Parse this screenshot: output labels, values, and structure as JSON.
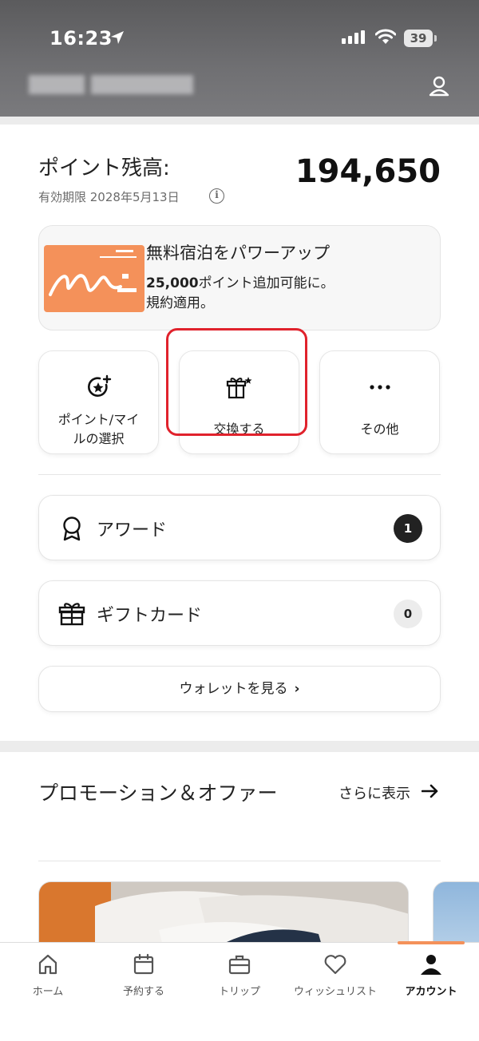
{
  "status_bar": {
    "time": "16:23",
    "battery": "39"
  },
  "points": {
    "label": "ポイント残高:",
    "value": "194,650",
    "expiry": "有効期限 2028年5月13日"
  },
  "promo_card": {
    "title": "無料宿泊をパワーアップ",
    "desc_bold": "25,000",
    "desc_rest": "ポイント追加可能に。",
    "desc_line2": "規約適用。"
  },
  "actions": [
    {
      "label_line1": "ポイント/マイ",
      "label_line2": "ルの選択",
      "icon": "star-plus-icon"
    },
    {
      "label_line1": "交換する",
      "icon": "gift-sparkle-icon"
    },
    {
      "label_line1": "その他",
      "icon": "more-dots-icon"
    }
  ],
  "list": {
    "awards": {
      "label": "アワード",
      "count": "1",
      "icon": "award-ribbon-icon"
    },
    "gift_cards": {
      "label": "ギフトカード",
      "count": "0",
      "icon": "gift-box-icon"
    }
  },
  "wallet": {
    "label": "ウォレットを見る"
  },
  "promotions": {
    "heading": "プロモーション＆オファー",
    "see_more": "さらに表示"
  },
  "nav": [
    {
      "label": "ホーム",
      "icon": "home-icon"
    },
    {
      "label": "予約する",
      "icon": "calendar-icon"
    },
    {
      "label": "トリップ",
      "icon": "suitcase-icon"
    },
    {
      "label": "ウィッシュリスト",
      "icon": "heart-icon"
    },
    {
      "label": "アカウント",
      "icon": "person-icon",
      "active": true
    }
  ],
  "colors": {
    "accent": "#f4915a",
    "highlight": "#e0222c",
    "dark": "#222222"
  }
}
